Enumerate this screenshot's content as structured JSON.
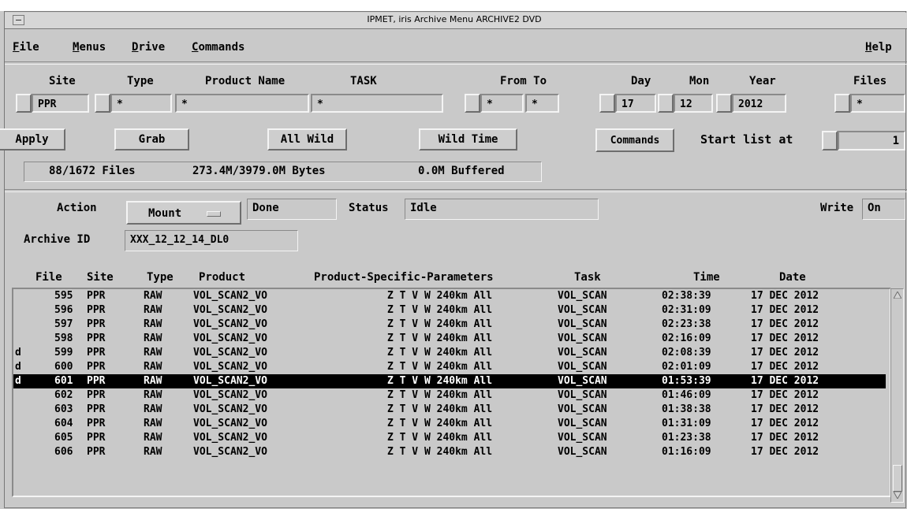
{
  "window": {
    "title": "IPMET, iris   Archive Menu ARCHIVE2 DVD"
  },
  "menubar": {
    "file": {
      "ul": "F",
      "rest": "ile"
    },
    "menus": {
      "ul": "M",
      "rest": "enus"
    },
    "drive": {
      "ul": "D",
      "rest": "rive"
    },
    "commands": {
      "ul": "C",
      "rest": "ommands"
    },
    "help": {
      "ul": "H",
      "rest": "elp"
    }
  },
  "filters": {
    "headers": {
      "site": "Site",
      "type": "Type",
      "product": "Product Name",
      "task": "TASK",
      "fromto": "From To",
      "day": "Day",
      "mon": "Mon",
      "year": "Year",
      "files": "Files"
    },
    "values": {
      "site": "PPR",
      "type": "*",
      "product": "*",
      "task": "*",
      "from": "*",
      "to": "*",
      "day": "17",
      "mon": "12",
      "year": "2012",
      "files": "*"
    }
  },
  "buttons": {
    "apply": "Apply",
    "grab": "Grab",
    "all_wild": "All Wild",
    "wild_time": "Wild Time",
    "commands": "Commands"
  },
  "start_list": {
    "label": "Start list at",
    "value": "1"
  },
  "summary": {
    "files": "88/1672 Files",
    "bytes": "273.4M/3979.0M Bytes",
    "buffered": "0.0M Buffered"
  },
  "action": {
    "label": "Action",
    "option": "Mount",
    "result": "Done",
    "status_label": "Status",
    "status": "Idle",
    "write_label": "Write",
    "write": "On"
  },
  "archive": {
    "label": "Archive ID",
    "value": "XXX_12_12_14_DL0"
  },
  "columns": {
    "file": "File",
    "site": "Site",
    "type": "Type",
    "product": "Product",
    "params": "Product-Specific-Parameters",
    "task": "Task",
    "time": "Time",
    "date": "Date"
  },
  "rows": [
    {
      "flag": "",
      "file": "595",
      "site": "PPR",
      "type": "RAW",
      "product": "VOL_SCAN2_VO",
      "params": "Z T V W 240km All",
      "task": "VOL_SCAN",
      "time": "02:38:39",
      "date": "17 DEC 2012"
    },
    {
      "flag": "",
      "file": "596",
      "site": "PPR",
      "type": "RAW",
      "product": "VOL_SCAN2_VO",
      "params": "Z T V W 240km All",
      "task": "VOL_SCAN",
      "time": "02:31:09",
      "date": "17 DEC 2012"
    },
    {
      "flag": "",
      "file": "597",
      "site": "PPR",
      "type": "RAW",
      "product": "VOL_SCAN2_VO",
      "params": "Z T V W 240km All",
      "task": "VOL_SCAN",
      "time": "02:23:38",
      "date": "17 DEC 2012"
    },
    {
      "flag": "",
      "file": "598",
      "site": "PPR",
      "type": "RAW",
      "product": "VOL_SCAN2_VO",
      "params": "Z T V W 240km All",
      "task": "VOL_SCAN",
      "time": "02:16:09",
      "date": "17 DEC 2012"
    },
    {
      "flag": "d",
      "file": "599",
      "site": "PPR",
      "type": "RAW",
      "product": "VOL_SCAN2_VO",
      "params": "Z T V W 240km All",
      "task": "VOL_SCAN",
      "time": "02:08:39",
      "date": "17 DEC 2012"
    },
    {
      "flag": "d",
      "file": "600",
      "site": "PPR",
      "type": "RAW",
      "product": "VOL_SCAN2_VO",
      "params": "Z T V W 240km All",
      "task": "VOL_SCAN",
      "time": "02:01:09",
      "date": "17 DEC 2012"
    },
    {
      "flag": "d",
      "file": "601",
      "site": "PPR",
      "type": "RAW",
      "product": "VOL_SCAN2_VO",
      "params": "Z T V W 240km All",
      "task": "VOL_SCAN",
      "time": "01:53:39",
      "date": "17 DEC 2012",
      "selected": true
    },
    {
      "flag": "",
      "file": "602",
      "site": "PPR",
      "type": "RAW",
      "product": "VOL_SCAN2_VO",
      "params": "Z T V W 240km All",
      "task": "VOL_SCAN",
      "time": "01:46:09",
      "date": "17 DEC 2012"
    },
    {
      "flag": "",
      "file": "603",
      "site": "PPR",
      "type": "RAW",
      "product": "VOL_SCAN2_VO",
      "params": "Z T V W 240km All",
      "task": "VOL_SCAN",
      "time": "01:38:38",
      "date": "17 DEC 2012"
    },
    {
      "flag": "",
      "file": "604",
      "site": "PPR",
      "type": "RAW",
      "product": "VOL_SCAN2_VO",
      "params": "Z T V W 240km All",
      "task": "VOL_SCAN",
      "time": "01:31:09",
      "date": "17 DEC 2012"
    },
    {
      "flag": "",
      "file": "605",
      "site": "PPR",
      "type": "RAW",
      "product": "VOL_SCAN2_VO",
      "params": "Z T V W 240km All",
      "task": "VOL_SCAN",
      "time": "01:23:38",
      "date": "17 DEC 2012"
    },
    {
      "flag": "",
      "file": "606",
      "site": "PPR",
      "type": "RAW",
      "product": "VOL_SCAN2_VO",
      "params": "Z T V W 240km All",
      "task": "VOL_SCAN",
      "time": "01:16:09",
      "date": "17 DEC 2012"
    }
  ]
}
